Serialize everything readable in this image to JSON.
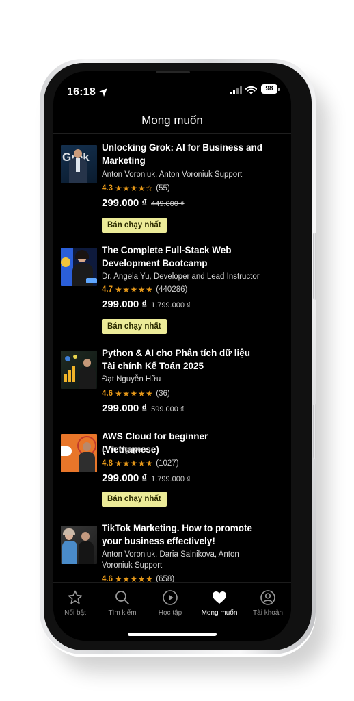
{
  "status_bar": {
    "time": "16:18",
    "battery": "98"
  },
  "header": {
    "title": "Mong muốn"
  },
  "courses": [
    {
      "title": "Unlocking Grok: AI for Business and Marketing",
      "authors": "Anton Voroniuk, Anton Voroniuk Support",
      "rating": "4.3",
      "stars": "★★★★☆",
      "reviews": "(55)",
      "price": "299.000 ₫",
      "old_price": "449.000 ₫",
      "badge": "Bán chạy nhất",
      "thumb_text": "Grok"
    },
    {
      "title": "The Complete Full-Stack Web Development Bootcamp",
      "authors": "Dr. Angela Yu, Developer and Lead Instructor",
      "rating": "4.7",
      "stars": "★★★★★",
      "reviews": "(440286)",
      "price": "299.000 ₫",
      "old_price": "1.799.000 ₫",
      "badge": "Bán chạy nhất"
    },
    {
      "title": "Python & AI cho Phân tích dữ liệu Tài chính Kế Toán 2025",
      "authors": "Đạt Nguyễn Hữu",
      "rating": "4.6",
      "stars": "★★★★★",
      "reviews": "(36)",
      "price": "299.000 ₫",
      "old_price": "599.000 ₫"
    },
    {
      "title": "AWS Cloud for beginner (Vietnamese)",
      "authors": "Linh Nguyen",
      "rating": "4.8",
      "stars": "★★★★★",
      "reviews": "(1027)",
      "price": "299.000 ₫",
      "old_price": "1.799.000 ₫",
      "badge": "Bán chạy nhất"
    },
    {
      "title": "TikTok Marketing. How to promote your business effectively!",
      "authors": "Anton Voroniuk, Daria Salnikova, Anton Voroniuk Support",
      "rating": "4.6",
      "stars": "★★★★★",
      "reviews": "(658)"
    }
  ],
  "tabs": [
    {
      "label": "Nổi bật",
      "icon": "star-icon"
    },
    {
      "label": "Tìm kiếm",
      "icon": "search-icon"
    },
    {
      "label": "Học tập",
      "icon": "play-icon"
    },
    {
      "label": "Mong muốn",
      "icon": "heart-icon",
      "active": true
    },
    {
      "label": "Tài khoản",
      "icon": "account-icon"
    }
  ],
  "colors": {
    "accent_star": "#e59819",
    "badge_bg": "#eceb98",
    "background": "#000000"
  }
}
